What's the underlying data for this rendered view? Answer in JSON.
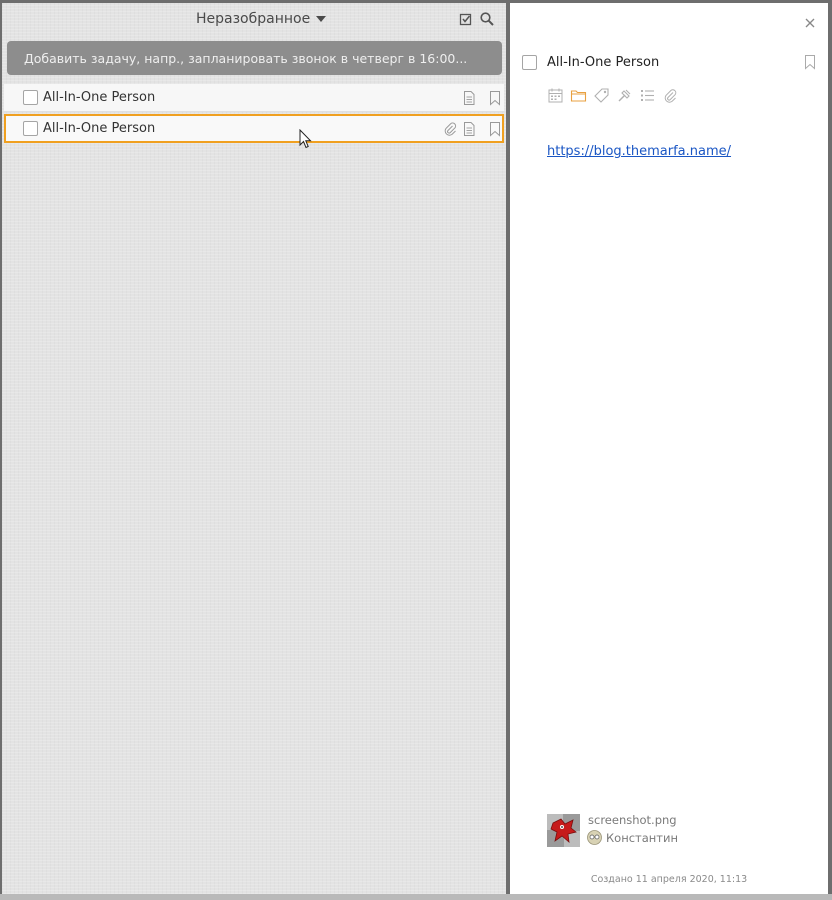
{
  "left": {
    "list_title": "Неразобранное",
    "add_task_placeholder": "Добавить задачу, напр., запланировать звонок в четверг в 16:00...",
    "tasks": [
      {
        "title": "All-In-One Person"
      },
      {
        "title": "All-In-One Person"
      }
    ]
  },
  "detail": {
    "title": "All-In-One Person",
    "link": "https://blog.themarfa.name/",
    "attachment_name": "screenshot.png",
    "author": "Константин",
    "created": "Создано 11 апреля 2020, 11:13"
  },
  "colors": {
    "selected_border": "#f0a020",
    "link": "#1a56c4",
    "add_task_bg": "#8d8d8d"
  },
  "icons": {
    "header": [
      "checkbox-icon",
      "search-icon"
    ],
    "row": [
      "attachment-icon",
      "note-icon",
      "bookmark-icon"
    ],
    "toolbar": [
      "calendar-icon",
      "folder-icon",
      "tag-icon",
      "priority-icon",
      "checklist-icon",
      "attachment-icon"
    ],
    "panel": [
      "close-icon",
      "bookmark-icon"
    ]
  }
}
